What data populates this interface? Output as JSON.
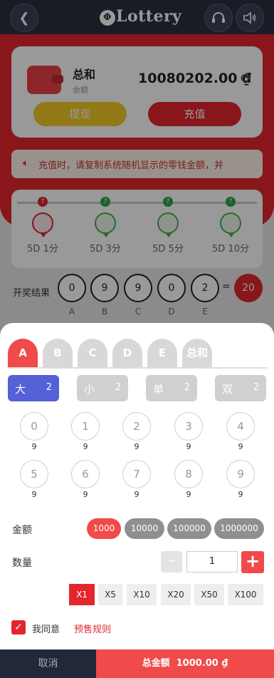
{
  "header": {
    "logo_text": "Lottery"
  },
  "wallet": {
    "title": "总和",
    "subtitle": "余额",
    "balance": "10080202.00 ₫",
    "withdraw_label": "提现",
    "deposit_label": "充值"
  },
  "notice": {
    "text": "充值时，请复制系统随机显示的零钱金额，并"
  },
  "periods": [
    {
      "label": "5D 1分"
    },
    {
      "label": "5D 3分"
    },
    {
      "label": "5D 5分"
    },
    {
      "label": "5D 10分"
    }
  ],
  "result": {
    "label": "开奖结果",
    "balls": [
      "0",
      "9",
      "9",
      "0",
      "2"
    ],
    "letters": [
      "A",
      "B",
      "C",
      "D",
      "E"
    ],
    "equals": "=",
    "sum": "20"
  },
  "tabs": [
    "A",
    "B",
    "C",
    "D",
    "E",
    "总和"
  ],
  "bet_chips": [
    {
      "label": "大",
      "odds": "2"
    },
    {
      "label": "小",
      "odds": "2"
    },
    {
      "label": "单",
      "odds": "2"
    },
    {
      "label": "双",
      "odds": "2"
    }
  ],
  "numbers": [
    {
      "n": "0",
      "odds": "9"
    },
    {
      "n": "1",
      "odds": "9"
    },
    {
      "n": "2",
      "odds": "9"
    },
    {
      "n": "3",
      "odds": "9"
    },
    {
      "n": "4",
      "odds": "9"
    },
    {
      "n": "5",
      "odds": "9"
    },
    {
      "n": "6",
      "odds": "9"
    },
    {
      "n": "7",
      "odds": "9"
    },
    {
      "n": "8",
      "odds": "9"
    },
    {
      "n": "9",
      "odds": "9"
    }
  ],
  "amount": {
    "label": "金额",
    "options": [
      "1000",
      "10000",
      "100000",
      "1000000"
    ],
    "selected": "1000"
  },
  "quantity": {
    "label": "数量",
    "minus": "–",
    "value": "1",
    "plus": "+"
  },
  "multipliers": [
    "X1",
    "X5",
    "X10",
    "X20",
    "X50",
    "X100"
  ],
  "agree": {
    "check": "✓",
    "text": "我同意",
    "link": "预售规则"
  },
  "footer": {
    "cancel_label": "取消",
    "total_label": "总金额",
    "total_value": "1000.00 ₫"
  },
  "colors": {
    "brand_red": "#e3262e",
    "selected_blue": "#5460d6",
    "dark": "#23273a"
  }
}
